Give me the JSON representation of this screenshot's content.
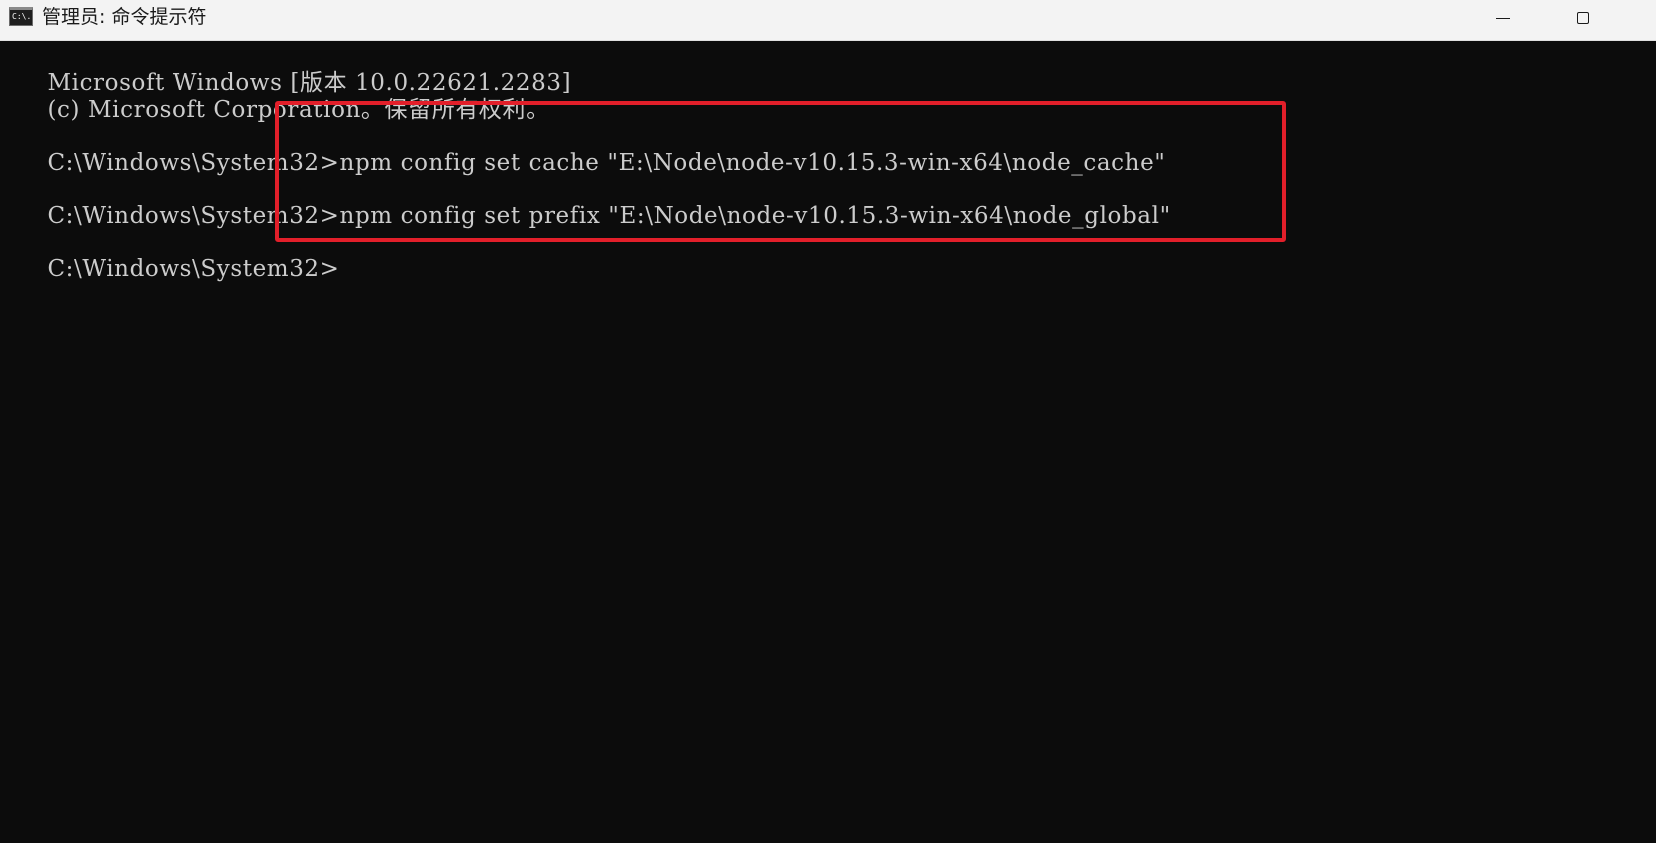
{
  "window": {
    "title": "管理员: 命令提示符",
    "icon": "cmd-icon",
    "icon_text": "C:\\.",
    "controls": {
      "minimize": "minimize-icon",
      "maximize": "maximize-icon"
    }
  },
  "console": {
    "lines": [
      {
        "text": "Microsoft Windows [版本 10.0.22621.2283]"
      },
      {
        "text": "(c) Microsoft Corporation。保留所有权利。"
      },
      {
        "prompt": "C:\\Windows\\System32>",
        "command": "npm config set cache \"E:\\Node\\node-v10.15.3-win-x64\\node_cache\""
      },
      {
        "prompt": "C:\\Windows\\System32>",
        "command": "npm config set prefix \"E:\\Node\\node-v10.15.3-win-x64\\node_global\""
      },
      {
        "prompt": "C:\\Windows\\System32>",
        "command": ""
      }
    ],
    "highlight_color": "#e21f2a",
    "background_color": "#0c0c0c",
    "text_color": "#cccccc"
  }
}
